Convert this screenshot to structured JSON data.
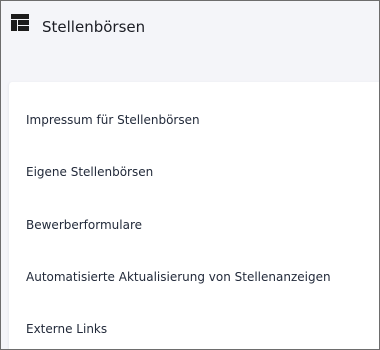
{
  "header": {
    "title": "Stellenbörsen",
    "icon": "dashboard-grid-icon"
  },
  "menu": {
    "items": [
      {
        "label": "Impressum für Stellenbörsen"
      },
      {
        "label": "Eigene Stellenbörsen"
      },
      {
        "label": "Bewerberformulare"
      },
      {
        "label": "Automatisierte Aktualisierung von Stellenanzeigen"
      },
      {
        "label": "Externe Links"
      }
    ]
  },
  "colors": {
    "page_background": "#f4f5f9",
    "card_background": "#ffffff",
    "text": "#222a3a",
    "border": "#6d6d6d"
  }
}
